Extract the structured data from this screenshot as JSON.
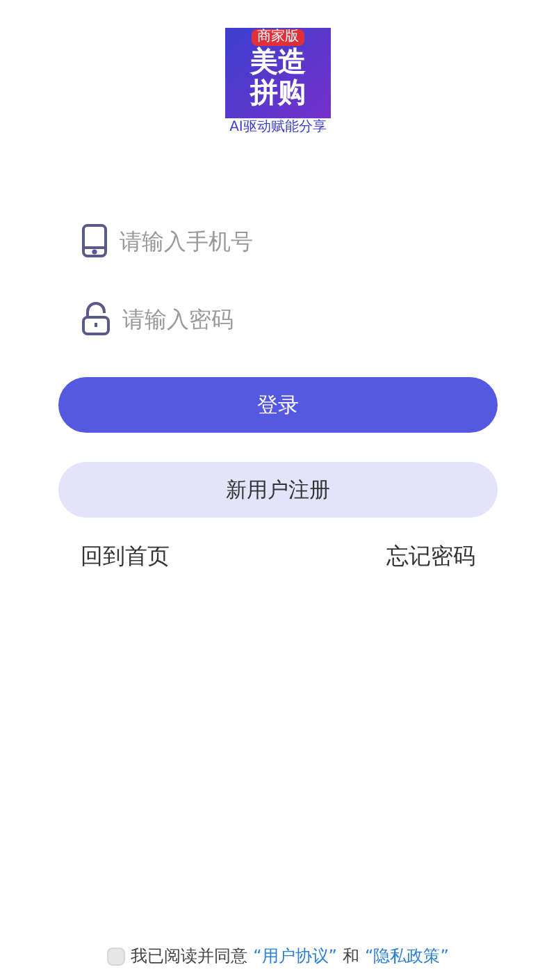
{
  "logo": {
    "badge": "商家版",
    "line_1": "美造",
    "line_2": "拼购",
    "slogan": "AI驱动赋能分享"
  },
  "fields": [
    {
      "kind": "phone",
      "placeholder": "请输入手机号"
    },
    {
      "kind": "password",
      "placeholder": "请输入密码"
    }
  ],
  "buttons": [
    {
      "kind": "primary",
      "label": "登录"
    },
    {
      "kind": "secondary",
      "label": "新用户注册"
    }
  ],
  "links": [
    "回到首页",
    "忘记密码"
  ],
  "agreement": {
    "checked": false,
    "text": "我已阅读并同意",
    "link_1": "“用户协议”",
    "joiner": "和",
    "link_2": "“隐私政策”"
  }
}
